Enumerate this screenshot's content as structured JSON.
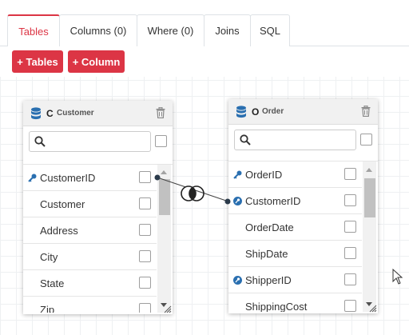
{
  "tabs": [
    {
      "label": "Tables",
      "active": true
    },
    {
      "label": "Columns (0)",
      "active": false
    },
    {
      "label": "Where (0)",
      "active": false
    },
    {
      "label": "Joins",
      "active": false
    },
    {
      "label": "SQL",
      "active": false
    }
  ],
  "toolbar": {
    "add_tables_label": "+ Tables",
    "add_column_label": "+ Column"
  },
  "tables": [
    {
      "letter": "C",
      "name": "Customer",
      "rows": [
        {
          "label": "CustomerID",
          "icon": "key-icon"
        },
        {
          "label": "Customer",
          "icon": ""
        },
        {
          "label": "Address",
          "icon": ""
        },
        {
          "label": "City",
          "icon": ""
        },
        {
          "label": "State",
          "icon": ""
        },
        {
          "label": "Zip",
          "icon": ""
        }
      ]
    },
    {
      "letter": "O",
      "name": "Order",
      "rows": [
        {
          "label": "OrderID",
          "icon": "key-icon"
        },
        {
          "label": "CustomerID",
          "icon": "foreign-key-icon"
        },
        {
          "label": "OrderDate",
          "icon": ""
        },
        {
          "label": "ShipDate",
          "icon": ""
        },
        {
          "label": "ShipperID",
          "icon": "foreign-key-icon"
        },
        {
          "label": "ShippingCost",
          "icon": ""
        }
      ]
    }
  ],
  "join": {
    "type": "inner-join-icon"
  },
  "colors": {
    "accent": "#dc3545",
    "key": "#2a6fb0"
  }
}
